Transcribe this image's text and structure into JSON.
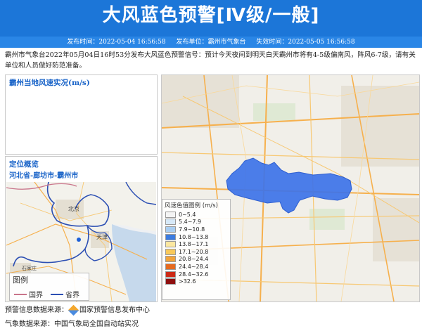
{
  "header": {
    "title": "大风蓝色预警[Ⅳ级/一般]",
    "publish_time": "发布时间：2022-05-04 16:56:58",
    "publisher": "发布单位：霸州市气象台",
    "expire_time": "失效时间：2022-05-05 16:56:58"
  },
  "description": "霸州市气象台2022年05月04日16时53分发布大风蓝色预警信号：预计今天夜间到明天白天霸州市将有4-5级偏南风，阵风6-7级，请有关单位和人员做好防范准备。",
  "wind_panel": {
    "title": "霸州当地风速实况(m/s)"
  },
  "location_panel": {
    "title": "定位概览",
    "subtitle": "河北省-廊坊市-霸州市"
  },
  "mini_map": {
    "labels": [
      "北京",
      "天津",
      "石家庄"
    ],
    "legend_title": "图例",
    "legend_items": [
      {
        "label": "国界",
        "color": "#c9748a"
      },
      {
        "label": "省界",
        "color": "#2c4fb3"
      }
    ]
  },
  "wind_legend": {
    "title": "风速色值图例 (m/s)",
    "items": [
      {
        "label": "0~5.4",
        "color": "#f4f4f4"
      },
      {
        "label": "5.4~7.9",
        "color": "#d7e9f8"
      },
      {
        "label": "7.9~10.8",
        "color": "#a9cdf1"
      },
      {
        "label": "10.8~13.8",
        "color": "#3b7be0"
      },
      {
        "label": "13.8~17.1",
        "color": "#fbe7a0"
      },
      {
        "label": "17.1~20.8",
        "color": "#f8c95a"
      },
      {
        "label": "20.8~24.4",
        "color": "#f2a33a"
      },
      {
        "label": "24.4~28.4",
        "color": "#e66a1f"
      },
      {
        "label": "28.4~32.6",
        "color": "#cc2a16"
      },
      {
        "label": ">32.6",
        "color": "#8e0f0f"
      }
    ]
  },
  "warning_area_color": "#3d73e8",
  "footer": {
    "warning_source_label": "预警信息数据来源：",
    "warning_source_name": "国家预警信息发布中心",
    "weather_source": "气象数据来源：中国气象局全国自动站实况"
  }
}
